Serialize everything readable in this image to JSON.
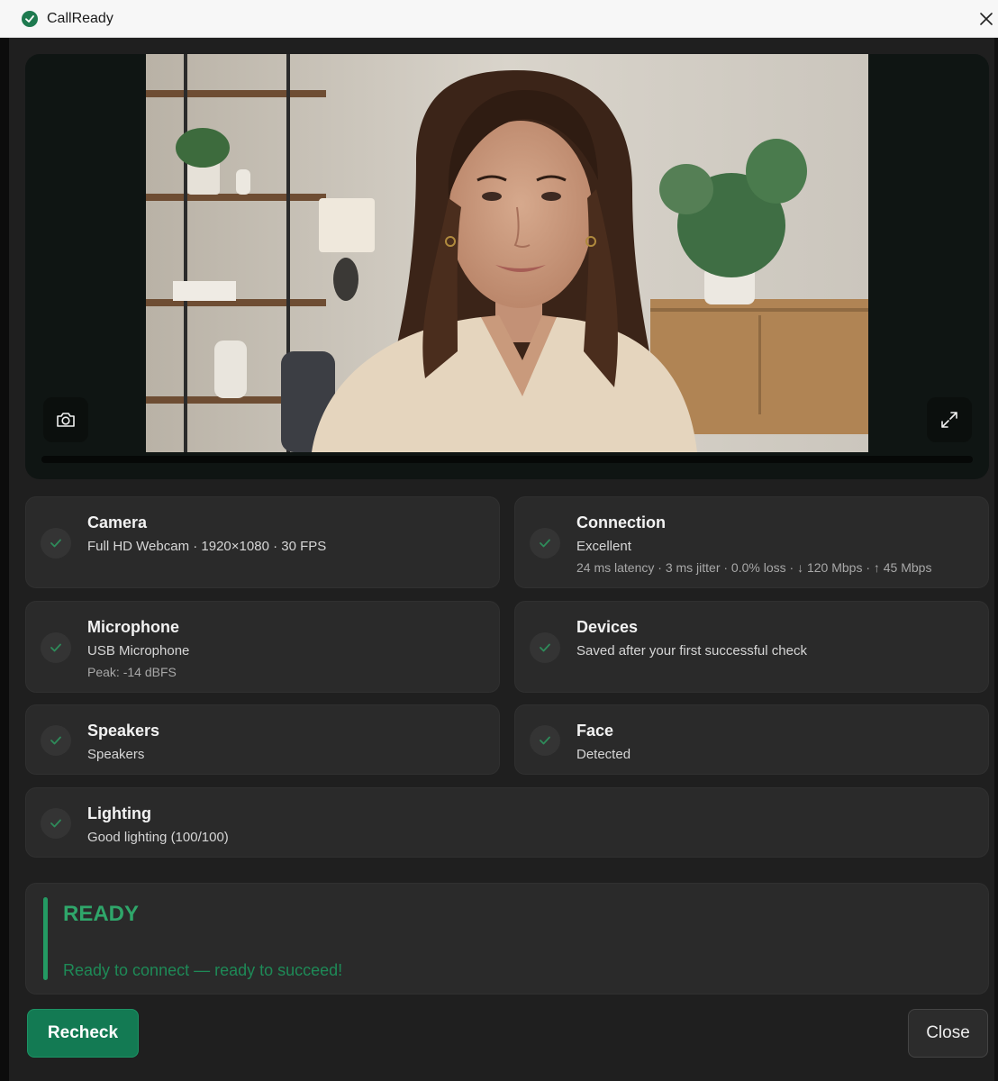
{
  "window": {
    "title": "CallReady"
  },
  "checks": [
    {
      "title": "Camera",
      "line1": "Full HD Webcam · 1920×1080 · 30 FPS",
      "line2": ""
    },
    {
      "title": "Connection",
      "line1": "Excellent",
      "line2": "24 ms latency · 3 ms jitter · 0.0% loss · ↓ 120 Mbps · ↑ 45 Mbps"
    },
    {
      "title": "Microphone",
      "line1": "USB Microphone",
      "line2": "Peak: -14 dBFS"
    },
    {
      "title": "Devices",
      "line1": "Saved after your first successful check",
      "line2": ""
    },
    {
      "title": "Speakers",
      "line1": "Speakers",
      "line2": ""
    },
    {
      "title": "Face",
      "line1": "Detected",
      "line2": ""
    },
    {
      "title": "Lighting",
      "line1": "Good lighting (100/100)",
      "line2": ""
    }
  ],
  "status": {
    "label": "READY",
    "message": "Ready to connect — ready to succeed!"
  },
  "buttons": {
    "recheck": "Recheck",
    "close": "Close"
  },
  "icons": {
    "app": "check-circle-icon",
    "close": "close-icon",
    "snapshot": "camera-icon",
    "expand": "expand-icon",
    "check": "check-icon"
  },
  "colors": {
    "accent": "#137a53",
    "success": "#2fa66a",
    "panel": "#2a2a2a",
    "background": "#1f1f1f"
  }
}
